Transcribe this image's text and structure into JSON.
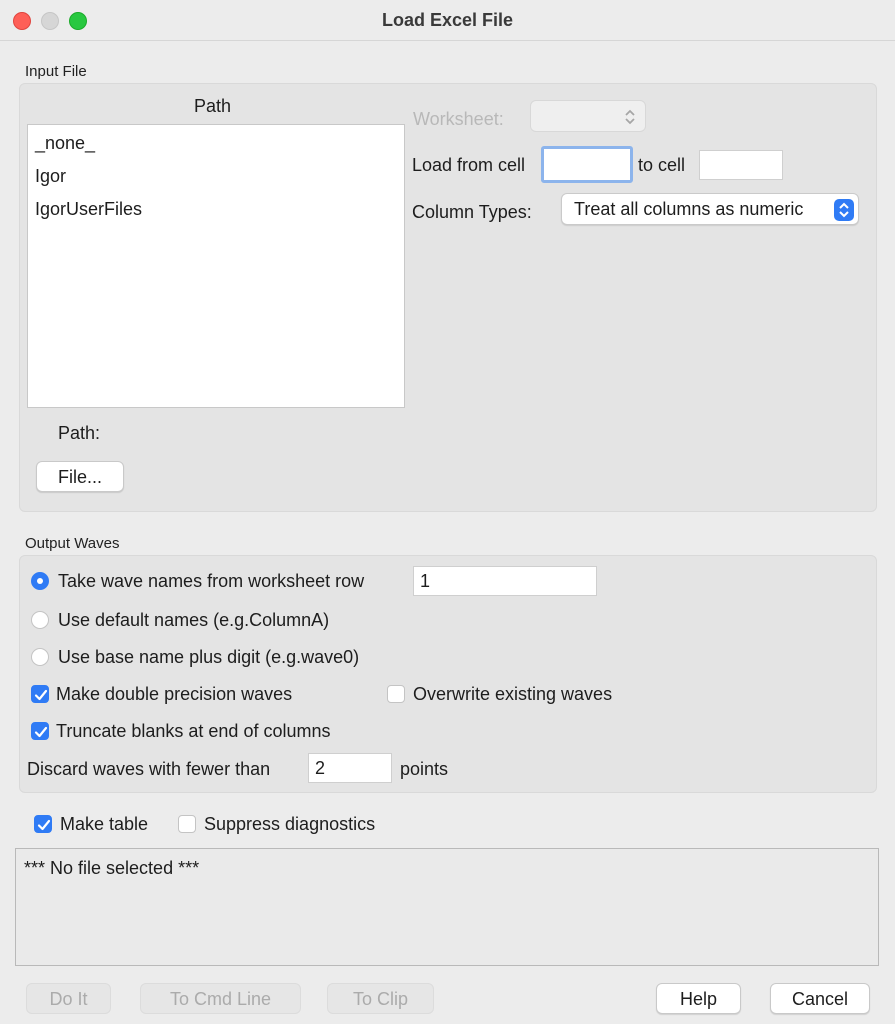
{
  "window": {
    "title": "Load Excel File"
  },
  "input_file": {
    "group_label": "Input File",
    "path_header": "Path",
    "path_items": [
      "_none_",
      "Igor",
      "IgorUserFiles"
    ],
    "path_label": "Path:",
    "file_button": "File...",
    "worksheet_label": "Worksheet:",
    "worksheet_value": "",
    "load_from_cell_label": "Load from cell",
    "load_from_cell_value": "",
    "to_cell_label": "to cell",
    "to_cell_value": "",
    "column_types_label": "Column Types:",
    "column_types_value": "Treat all columns as numeric"
  },
  "output_waves": {
    "group_label": "Output Waves",
    "radio_worksheet_row": "Take wave names from worksheet row",
    "worksheet_row_value": "1",
    "radio_default_names": "Use default names (e.g.ColumnA)",
    "radio_base_name": "Use base name plus digit (e.g.wave0)",
    "double_precision": "Make double precision waves",
    "overwrite": "Overwrite existing waves",
    "truncate_blanks": "Truncate blanks at end of columns",
    "discard_label": "Discard waves with fewer than",
    "discard_value": "2",
    "points_label": "points"
  },
  "options": {
    "make_table": "Make table",
    "suppress_diagnostics": "Suppress diagnostics"
  },
  "status": {
    "text": "*** No file selected ***"
  },
  "buttons": {
    "do_it": "Do It",
    "to_cmd_line": "To Cmd Line",
    "to_clip": "To Clip",
    "help": "Help",
    "cancel": "Cancel"
  },
  "colors": {
    "accent": "#2f7bf5",
    "focus_ring": "#8cb4ec"
  }
}
